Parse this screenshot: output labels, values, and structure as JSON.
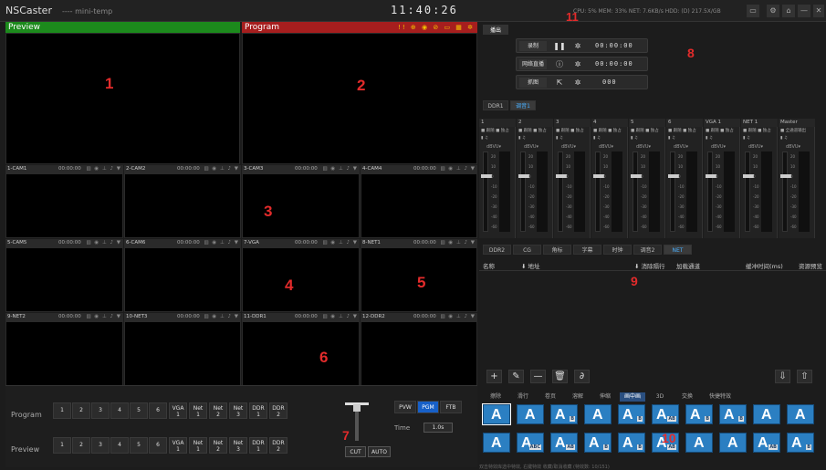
{
  "titlebar": {
    "app": "NSCaster",
    "project": "---- mini-temp",
    "clock": "11:40:26",
    "stats": "CPU: 5%   MEM: 33%   NET: 7.6KB/s   HDD: (D) 217.5X/GB"
  },
  "callouts": [
    "1",
    "2",
    "3",
    "4",
    "5",
    "6",
    "7",
    "8",
    "9",
    "10",
    "11"
  ],
  "preview": {
    "label": "Preview"
  },
  "program": {
    "label": "Program",
    "icons": "!! ⊕ ◉ ⊘ ▭ ▦ ✲"
  },
  "multiview": [
    {
      "name": "1-CAM1",
      "time": "00:00:00"
    },
    {
      "name": "2-CAM2",
      "time": "00:00:00"
    },
    {
      "name": "3-CAM3",
      "time": "00:00:00"
    },
    {
      "name": "4-CAM4",
      "time": "00:00:00"
    },
    {
      "name": "5-CAM5",
      "time": "00:00:00"
    },
    {
      "name": "6-CAM6",
      "time": "00:00:00"
    },
    {
      "name": "7-VGA",
      "time": "00:00:00"
    },
    {
      "name": "8-NET1",
      "time": "00:00:00"
    },
    {
      "name": "9-NET2",
      "time": "00:00:00"
    },
    {
      "name": "10-NET3",
      "time": "00:00:00"
    },
    {
      "name": "11-DDR1",
      "time": "00:00:00"
    },
    {
      "name": "12-DDR2",
      "time": "00:00:00"
    }
  ],
  "mv_icons": "▥ ◉ ⊥ ♪ ▼",
  "bus": {
    "program_label": "Program",
    "preview_label": "Preview",
    "buttons": [
      [
        "1",
        ""
      ],
      [
        "2",
        ""
      ],
      [
        "3",
        ""
      ],
      [
        "4",
        ""
      ],
      [
        "5",
        ""
      ],
      [
        "6",
        ""
      ],
      [
        "VGA",
        "1"
      ],
      [
        "Net",
        "1"
      ],
      [
        "Net",
        "2"
      ],
      [
        "Net",
        "3"
      ],
      [
        "DDR",
        "1"
      ],
      [
        "DDR",
        "2"
      ]
    ]
  },
  "transition": {
    "pvw": "PVW",
    "pgm": "PGM",
    "ftb": "FTB",
    "time_label": "Time",
    "time_value": "1.0s",
    "cut": "CUT",
    "auto": "AUTO"
  },
  "right": {
    "top_tab": "播出",
    "record": {
      "label": "录制",
      "time": "00:00:00"
    },
    "stream": {
      "label": "网络直播",
      "time": "00:00:00"
    },
    "snapshot": {
      "label": "抓图",
      "count": "000"
    },
    "audio_tabs": [
      "DDR1",
      "调音1"
    ],
    "mixer": [
      {
        "name": "1",
        "btns": "■ 跟随 ■ 独占",
        "vu": "dBVU▾"
      },
      {
        "name": "2",
        "btns": "■ 跟随 ■ 独占",
        "vu": "dBVU▾"
      },
      {
        "name": "3",
        "btns": "■ 跟随 ■ 独占",
        "vu": "dBVU▾"
      },
      {
        "name": "4",
        "btns": "■ 跟随 ■ 独占",
        "vu": "dBVU▾"
      },
      {
        "name": "5",
        "btns": "■ 跟随 ■ 独占",
        "vu": "dBVU▾"
      },
      {
        "name": "6",
        "btns": "■ 跟随 ■ 独占",
        "vu": "dBVU▾"
      },
      {
        "name": "VGA 1",
        "btns": "■ 跟随 ■ 独占",
        "vu": "dBVU▾"
      },
      {
        "name": "NET 1",
        "btns": "■ 跟随 ■ 独占",
        "vu": "dBVU▾"
      },
      {
        "name": "Master",
        "btns": "■ 全通道输出",
        "vu": "dBVU▾"
      }
    ],
    "scale": [
      "20",
      "10",
      "0",
      "-10",
      "-20",
      "-30",
      "-40",
      "-60"
    ],
    "src_tabs": [
      "DDR2",
      "CG",
      "角标",
      "字幕",
      "时钟",
      "调音2",
      "NET"
    ],
    "net_headers": [
      "名称",
      "⬇ 地址",
      "⬇ 消除隔行",
      "加载通道",
      "缓冲时间(ms)",
      "资源预览"
    ],
    "fx_tabs": [
      "擦除",
      "滑行",
      "卷页",
      "溶解",
      "伸缩",
      "画中画",
      "3D",
      "交换",
      "快捷特效"
    ],
    "fx_rows": [
      [
        {
          "b": ""
        },
        {
          "b": ""
        },
        {
          "b": "B"
        },
        {
          "b": ""
        },
        {
          "b": "B"
        },
        {
          "b": "AB"
        },
        {
          "b": "B"
        },
        {
          "b": "B"
        },
        {
          "b": ""
        },
        {
          "b": ""
        }
      ],
      [
        {
          "b": ""
        },
        {
          "b": "ABC"
        },
        {
          "b": "AB"
        },
        {
          "b": "B"
        },
        {
          "b": "B"
        },
        {
          "b": "AB"
        },
        {
          "b": ""
        },
        {
          "b": ""
        },
        {
          "b": "AB"
        },
        {
          "b": "B"
        }
      ]
    ],
    "footnote": "双击特效库选中特效, 右键特效 收藏/取消收藏 (特效数: 10/151)"
  }
}
